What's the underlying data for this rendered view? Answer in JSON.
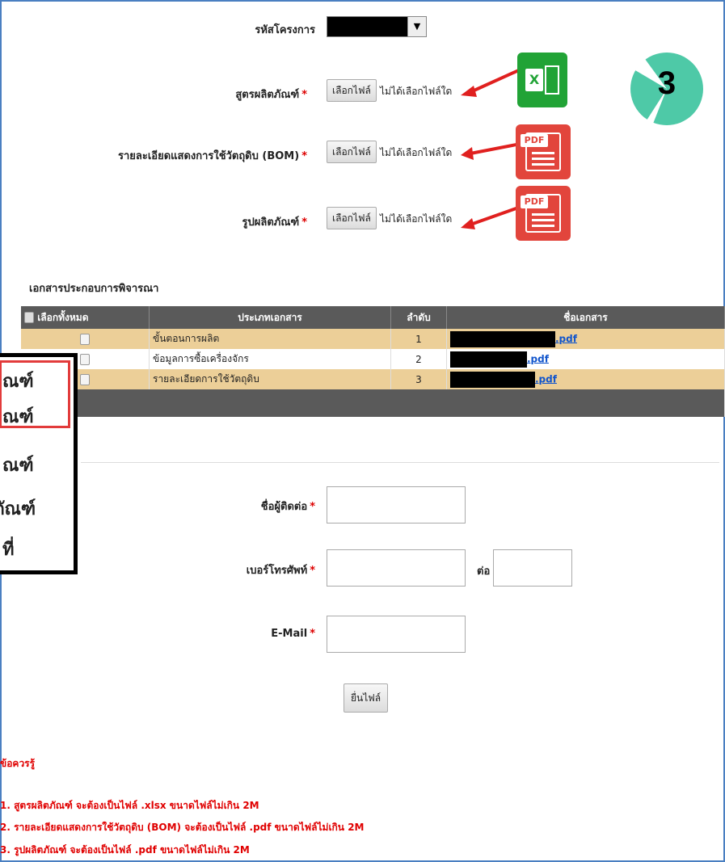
{
  "project_code": {
    "label": "รหัสโครงการ",
    "dropdown_arrow": "▼"
  },
  "upload_rows": [
    {
      "label": "สูตรผลิตภัณฑ์",
      "button": "เลือกไฟล์",
      "status": "ไม่ได้เลือกไฟล์ใด",
      "icon": "excel-icon"
    },
    {
      "label": "รายละเอียดแสดงการใช้วัตถุดิบ (BOM)",
      "button": "เลือกไฟล์",
      "status": "ไม่ได้เลือกไฟล์ใด",
      "icon": "pdf-icon"
    },
    {
      "label": "รูปผลิตภัณฑ์",
      "button": "เลือกไฟล์",
      "status": "ไม่ได้เลือกไฟล์ใด",
      "icon": "pdf-icon"
    }
  ],
  "required_mark": "*",
  "step_badge": "3",
  "excel_icon_text": "X",
  "pdf_icon_text": "PDF",
  "docs_section_title": "เอกสารประกอบการพิจารณา",
  "docs_table": {
    "headers": [
      "เลือกทั้งหมด",
      "ประเภทเอกสาร",
      "ลำดับ",
      "ชื่อเอกสาร"
    ],
    "rows": [
      {
        "type": "ขั้นตอนการผลิต",
        "order": "1",
        "file_ext": ".pdf"
      },
      {
        "type": "ข้อมูลการซื้อเครื่องจักร",
        "order": "2",
        "file_ext": ".pdf"
      },
      {
        "type": "รายละเอียดการใช้วัตถุดิบ",
        "order": "3",
        "file_ext": ".pdf"
      }
    ]
  },
  "popup_items": [
    "ณฑ์",
    "ณฑ์",
    "ณฑ์",
    "ภัณฑ์",
    "ที่"
  ],
  "contact": {
    "name_label": "ชื่อผู้ติดต่อ",
    "phone_label": "เบอร์โทรศัพท์",
    "ext_label": "ต่อ",
    "email_label": "E-Mail"
  },
  "submit_label": "ยื่นไฟล์",
  "notes": {
    "title": "ข้อควรรู้",
    "items": [
      "1. สูตรผลิตภัณฑ์ จะต้องเป็นไฟล์ .xlsx ขนาดไฟล์ไม่เกิน 2M",
      "2. รายละเอียดแสดงการใช้วัตถุดิบ (BOM) จะต้องเป็นไฟล์ .pdf ขนาดไฟล์ไม่เกิน 2M",
      "3. รูปผลิตภัณฑ์ จะต้องเป็นไฟล์ .pdf ขนาดไฟล์ไม่เกิน 2M"
    ]
  },
  "colors": {
    "header_bg": "#5a5a5a",
    "row_highlight": "#eccf98",
    "excel_green": "#21a336",
    "pdf_red": "#e2453c",
    "badge_teal": "#4ec9a7",
    "note_red": "#e00000",
    "arrow_red": "#e0201f"
  }
}
